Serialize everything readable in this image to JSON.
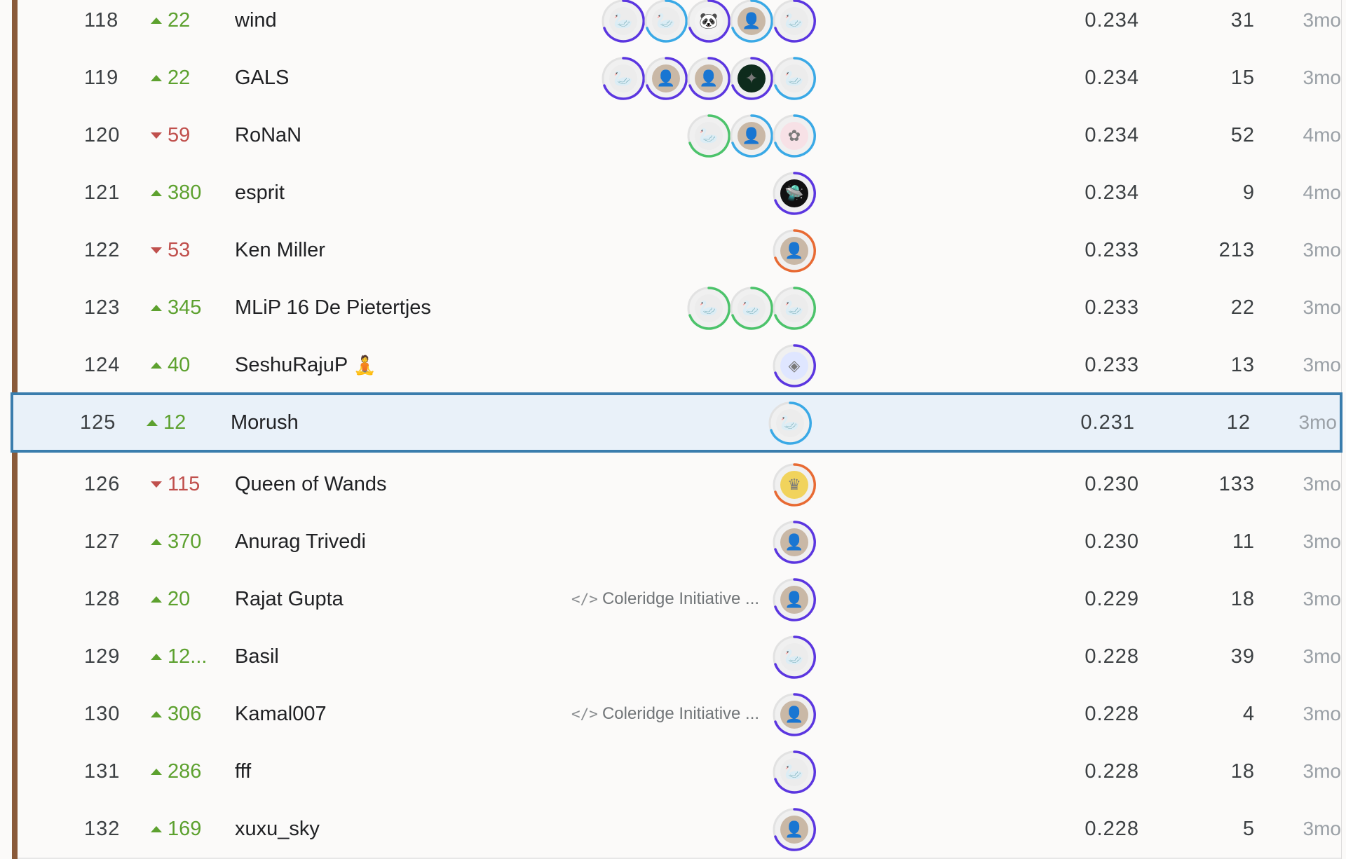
{
  "leaderboard": {
    "rows": [
      {
        "rank": "118",
        "delta": "22",
        "dir": "up",
        "name": "wind",
        "tag": "",
        "score": "0.234",
        "entries": "31",
        "last": "3mo",
        "avatars": [
          {
            "icon": "goose-icon",
            "ring": "purple"
          },
          {
            "icon": "goose-icon",
            "ring": "blue"
          },
          {
            "icon": "cartoon-avatar-icon",
            "ring": "purple"
          },
          {
            "icon": "person-avatar-icon",
            "ring": "blue"
          },
          {
            "icon": "goose-icon",
            "ring": "purple"
          }
        ]
      },
      {
        "rank": "119",
        "delta": "22",
        "dir": "up",
        "name": "GALS",
        "tag": "",
        "score": "0.234",
        "entries": "15",
        "last": "3mo",
        "avatars": [
          {
            "icon": "goose-icon",
            "ring": "purple"
          },
          {
            "icon": "person-avatar-icon",
            "ring": "purple"
          },
          {
            "icon": "person-avatar-icon",
            "ring": "purple"
          },
          {
            "icon": "aurora-avatar-icon",
            "ring": "purple"
          },
          {
            "icon": "goose-icon",
            "ring": "blue"
          }
        ]
      },
      {
        "rank": "120",
        "delta": "59",
        "dir": "down",
        "name": "RoNaN",
        "tag": "",
        "score": "0.234",
        "entries": "52",
        "last": "4mo",
        "avatars": [
          {
            "icon": "goose-icon",
            "ring": "green"
          },
          {
            "icon": "person-avatar-icon",
            "ring": "blue"
          },
          {
            "icon": "drawing-avatar-icon",
            "ring": "blue"
          }
        ]
      },
      {
        "rank": "121",
        "delta": "380",
        "dir": "up",
        "name": "esprit",
        "tag": "",
        "score": "0.234",
        "entries": "9",
        "last": "4mo",
        "avatars": [
          {
            "icon": "ufo-avatar-icon",
            "ring": "purple"
          }
        ]
      },
      {
        "rank": "122",
        "delta": "53",
        "dir": "down",
        "name": "Ken Miller",
        "tag": "",
        "score": "0.233",
        "entries": "213",
        "last": "3mo",
        "avatars": [
          {
            "icon": "person-avatar-icon",
            "ring": "orange"
          }
        ]
      },
      {
        "rank": "123",
        "delta": "345",
        "dir": "up",
        "name": "MLiP 16 De Pietertjes",
        "tag": "",
        "score": "0.233",
        "entries": "22",
        "last": "3mo",
        "avatars": [
          {
            "icon": "goose-icon",
            "ring": "green"
          },
          {
            "icon": "goose-icon",
            "ring": "green"
          },
          {
            "icon": "goose-icon",
            "ring": "green"
          }
        ]
      },
      {
        "rank": "124",
        "delta": "40",
        "dir": "up",
        "name": "SeshuRajuP",
        "emoji": "🧘",
        "tag": "",
        "score": "0.233",
        "entries": "13",
        "last": "3mo",
        "avatars": [
          {
            "icon": "chip-avatar-icon",
            "ring": "purple"
          }
        ]
      },
      {
        "rank": "125",
        "delta": "12",
        "dir": "up",
        "name": "Morush",
        "tag": "",
        "score": "0.231",
        "entries": "12",
        "last": "3mo",
        "highlight": true,
        "avatars": [
          {
            "icon": "goose-icon",
            "ring": "blue"
          }
        ]
      },
      {
        "rank": "126",
        "delta": "115",
        "dir": "down",
        "name": "Queen of Wands",
        "tag": "",
        "score": "0.230",
        "entries": "133",
        "last": "3mo",
        "avatars": [
          {
            "icon": "tarot-avatar-icon",
            "ring": "orange"
          }
        ]
      },
      {
        "rank": "127",
        "delta": "370",
        "dir": "up",
        "name": "Anurag Trivedi",
        "tag": "",
        "score": "0.230",
        "entries": "11",
        "last": "3mo",
        "avatars": [
          {
            "icon": "person-avatar-icon",
            "ring": "purple"
          }
        ]
      },
      {
        "rank": "128",
        "delta": "20",
        "dir": "up",
        "name": "Rajat Gupta",
        "tag": "Coleridge Initiative ...",
        "score": "0.229",
        "entries": "18",
        "last": "3mo",
        "avatars": [
          {
            "icon": "person-avatar-icon",
            "ring": "purple"
          }
        ]
      },
      {
        "rank": "129",
        "delta": "12...",
        "dir": "up",
        "name": "Basil",
        "tag": "",
        "score": "0.228",
        "entries": "39",
        "last": "3mo",
        "avatars": [
          {
            "icon": "goose-icon",
            "ring": "purple"
          }
        ]
      },
      {
        "rank": "130",
        "delta": "306",
        "dir": "up",
        "name": "Kamal007",
        "tag": "Coleridge Initiative ...",
        "score": "0.228",
        "entries": "4",
        "last": "3mo",
        "avatars": [
          {
            "icon": "person-avatar-icon",
            "ring": "purple"
          }
        ]
      },
      {
        "rank": "131",
        "delta": "286",
        "dir": "up",
        "name": "fff",
        "tag": "",
        "score": "0.228",
        "entries": "18",
        "last": "3mo",
        "avatars": [
          {
            "icon": "goose-icon",
            "ring": "purple"
          }
        ]
      },
      {
        "rank": "132",
        "delta": "169",
        "dir": "up",
        "name": "xuxu_sky",
        "tag": "",
        "score": "0.228",
        "entries": "5",
        "last": "3mo",
        "avatars": [
          {
            "icon": "person-avatar-icon",
            "ring": "purple"
          }
        ]
      }
    ]
  },
  "colors": {
    "up": "#5da12f",
    "down": "#c0504d",
    "highlight_border": "#3a7dad",
    "highlight_bg": "#e9f1f9",
    "medal_bar": "#8a5a3a",
    "ring_purple": "#5b36e0",
    "ring_blue": "#3aa9e6",
    "ring_green": "#4cc36b",
    "ring_orange": "#e86a33"
  },
  "icons": {
    "code": "</>"
  }
}
